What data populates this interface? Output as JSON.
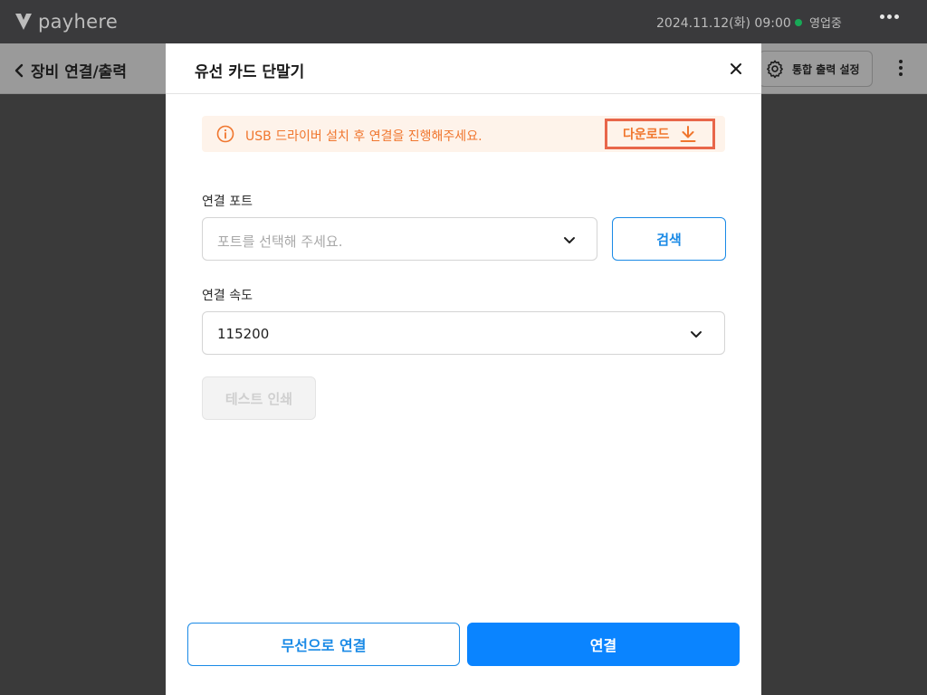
{
  "topbar": {
    "brand": "payhere",
    "datetime": "2024.11.12(화) 09:00",
    "status": "영업중",
    "colors": {
      "status_dot": "#18a957"
    },
    "menu_icon": "more-horizontal-icon"
  },
  "subheader": {
    "back_title": "장비 연결/출력",
    "integrated_button": "통합 출력 설정",
    "icons": [
      "chevron-left-icon",
      "gear-icon",
      "more-vertical-icon"
    ]
  },
  "modal": {
    "title": "유선 카드 단말기",
    "close_icon": "close-icon",
    "notice": {
      "text": "USB 드라이버 설치 후 연결을 진행해주세요.",
      "download_label": "다운로드",
      "colors": {
        "accent": "#f0762e",
        "background": "#fef3ea",
        "highlight_border": "#e8664a"
      }
    },
    "port": {
      "label": "연결 포트",
      "placeholder": "포트를 선택해 주세요.",
      "search_label": "검색"
    },
    "speed": {
      "label": "연결 속도",
      "value": "115200"
    },
    "test_print_label": "테스트 인쇄",
    "footer": {
      "wireless_label": "무선으로 연결",
      "connect_label": "연결"
    },
    "colors": {
      "primary": "#0a84ff",
      "primary_outline": "#1a8ae6"
    }
  }
}
